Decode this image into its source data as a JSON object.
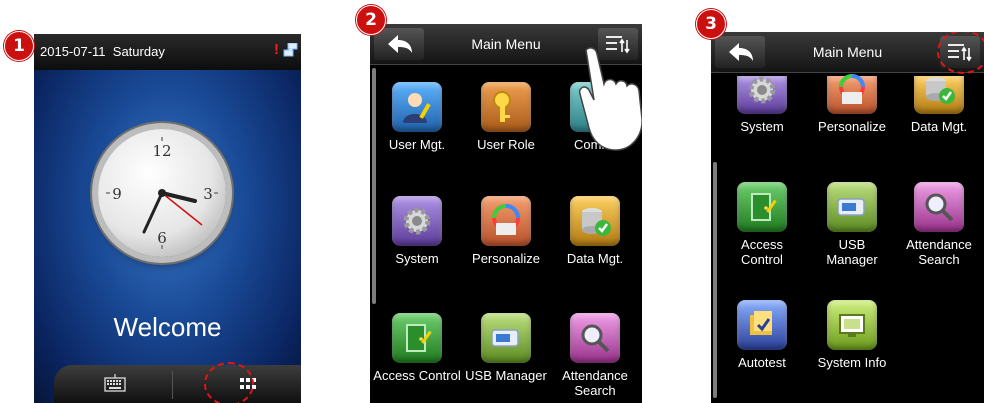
{
  "steps": [
    "1",
    "2",
    "3"
  ],
  "panel1": {
    "date": "2015-07-11",
    "day": "Saturday",
    "welcome": "Welcome",
    "clock_numbers": [
      "12",
      "3",
      "6",
      "9"
    ],
    "colors": {
      "background": "#1a4b98",
      "alert": "#ff1a1a",
      "highlight_ring": "#e01515"
    }
  },
  "panel2": {
    "title": "Main Menu",
    "items": [
      {
        "label": "User Mgt.",
        "icon": "user-mgt-icon",
        "color": "#2f82c9"
      },
      {
        "label": "User Role",
        "icon": "user-role-icon",
        "color": "#c77a28"
      },
      {
        "label": "Comm.",
        "icon": "comm-icon",
        "color": "#3aa0a0"
      },
      {
        "label": "System",
        "icon": "system-gear-icon",
        "color": "#7a55b8"
      },
      {
        "label": "Personalize",
        "icon": "personalize-icon",
        "color": "#d9743f"
      },
      {
        "label": "Data Mgt.",
        "icon": "data-mgt-icon",
        "color": "#d9a020"
      },
      {
        "label": "Access Control",
        "icon": "access-control-icon",
        "color": "#3aa03a"
      },
      {
        "label": "USB Manager",
        "icon": "usb-manager-icon",
        "color": "#7fae45"
      },
      {
        "label": "Attendance Search",
        "icon": "attendance-search-icon",
        "color": "#c860b8"
      }
    ]
  },
  "panel3": {
    "title": "Main Menu",
    "items": [
      {
        "label": "System",
        "icon": "system-gear-icon",
        "color": "#7a55b8"
      },
      {
        "label": "Personalize",
        "icon": "personalize-icon",
        "color": "#d9743f"
      },
      {
        "label": "Data Mgt.",
        "icon": "data-mgt-icon",
        "color": "#d9a020"
      },
      {
        "label": "Access Control",
        "icon": "access-control-icon",
        "color": "#3aa03a"
      },
      {
        "label": "USB Manager",
        "icon": "usb-manager-icon",
        "color": "#7fae45"
      },
      {
        "label": "Attendance Search",
        "icon": "attendance-search-icon",
        "color": "#c860b8"
      },
      {
        "label": "Autotest",
        "icon": "autotest-icon",
        "color": "#3b5fb8"
      },
      {
        "label": "System Info",
        "icon": "system-info-icon",
        "color": "#8ab83a"
      }
    ]
  }
}
